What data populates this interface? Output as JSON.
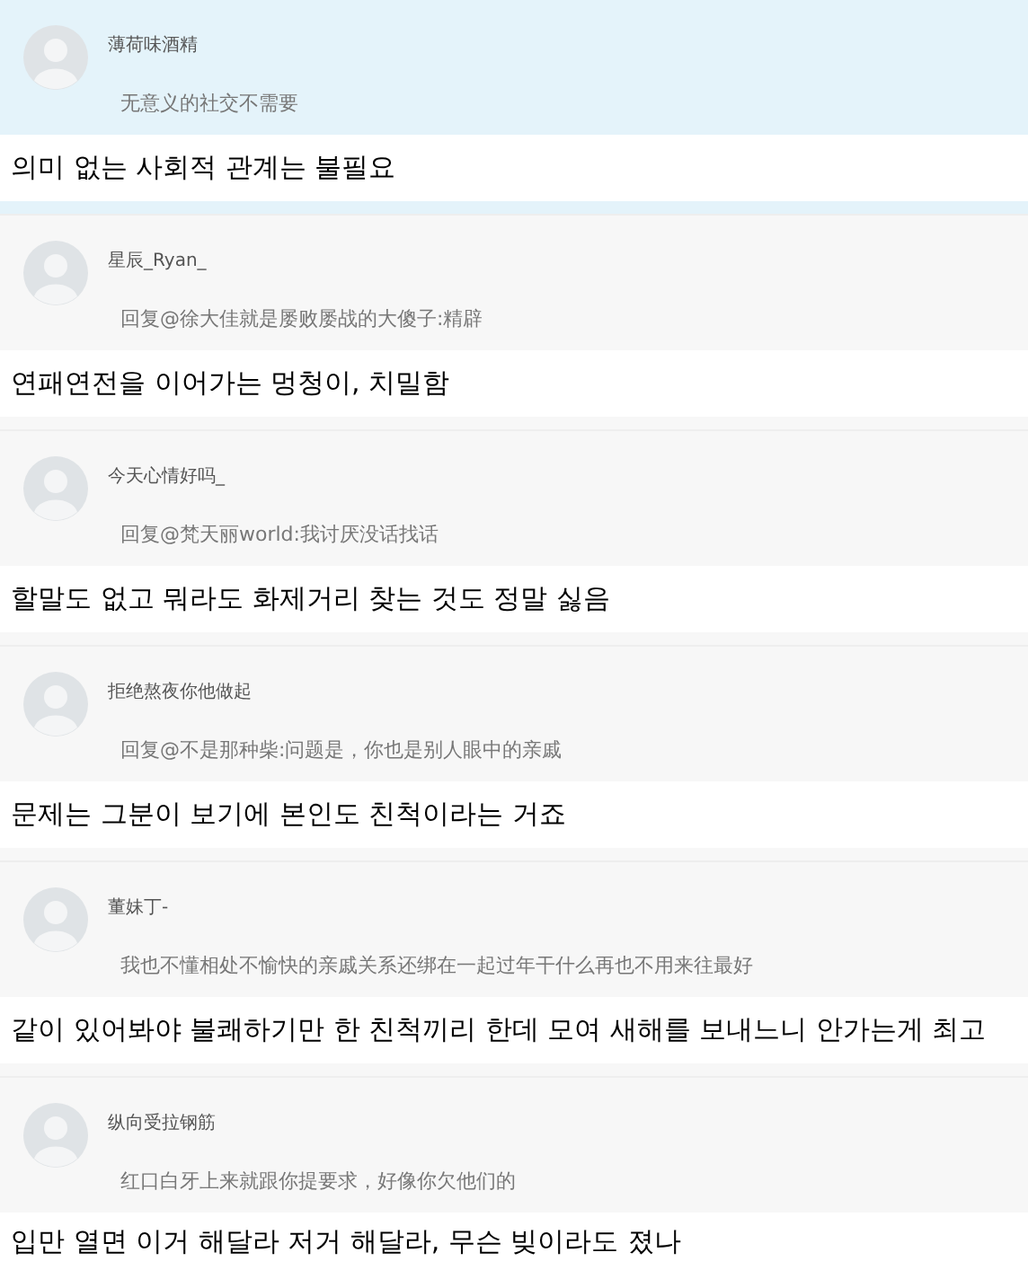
{
  "comments": [
    {
      "user": "薄荷味酒精",
      "text": "无意义的社交不需要",
      "caption": "의미 없는 사회적 관계는 불필요",
      "highlighted": true
    },
    {
      "user": "星辰_Ryan_",
      "text": "回复@徐大佳就是屡败屡战的大傻子:精辟",
      "caption": "연패연전을 이어가는 멍청이, 치밀함",
      "highlighted": false
    },
    {
      "user": "今天心情好吗_",
      "text": "回复@梵天丽world:我讨厌没话找话",
      "caption": "할말도 없고 뭐라도 화제거리 찾는 것도 정말 싫음",
      "highlighted": false
    },
    {
      "user": "拒绝熬夜你他做起",
      "text": "回复@不是那种柴:问题是，你也是别人眼中的亲戚",
      "caption": "문제는 그분이 보기에 본인도 친척이라는 거죠",
      "highlighted": false
    },
    {
      "user": "董妹丁-",
      "text": "我也不懂相处不愉快的亲戚关系还绑在一起过年干什么再也不用来往最好",
      "caption": "같이 있어봐야 불쾌하기만 한 친척끼리 한데 모여 새해를 보내느니 안가는게 최고",
      "highlighted": false
    },
    {
      "user": "纵向受拉钢筋",
      "text": "红口白牙上来就跟你提要求，好像你欠他们的",
      "caption": "입만 열면 이거 해달라 저거 해달라, 무슨 빚이라도 졌나",
      "highlighted": false
    }
  ]
}
